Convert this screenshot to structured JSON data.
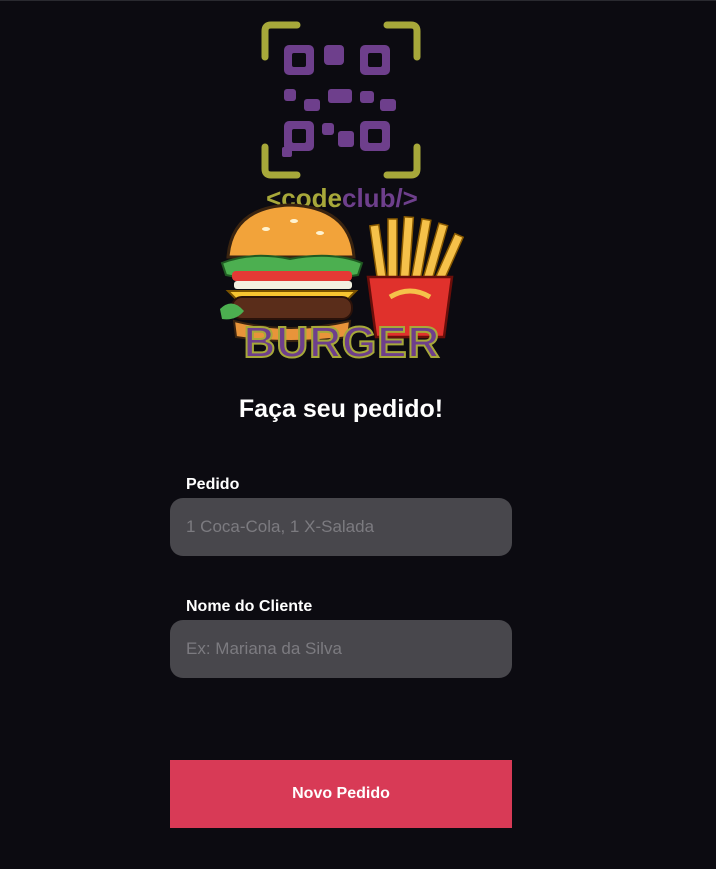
{
  "logo": {
    "top_text": "<codeclub/>",
    "brand_text": "BURGER",
    "colors": {
      "purple": "#6e3f8c",
      "olive": "#a7a83a",
      "bun": "#f2a33a",
      "fries": "#f5c14a",
      "carton": "#e0312c"
    }
  },
  "title": "Faça seu pedido!",
  "form": {
    "order": {
      "label": "Pedido",
      "placeholder": "1 Coca-Cola, 1 X-Salada",
      "value": ""
    },
    "customer": {
      "label": "Nome do Cliente",
      "placeholder": "Ex: Mariana da Silva",
      "value": ""
    },
    "submit_label": "Novo Pedido"
  },
  "colors": {
    "background": "#0c0b11",
    "input_bg": "#48474c",
    "button": "#d83a56"
  }
}
